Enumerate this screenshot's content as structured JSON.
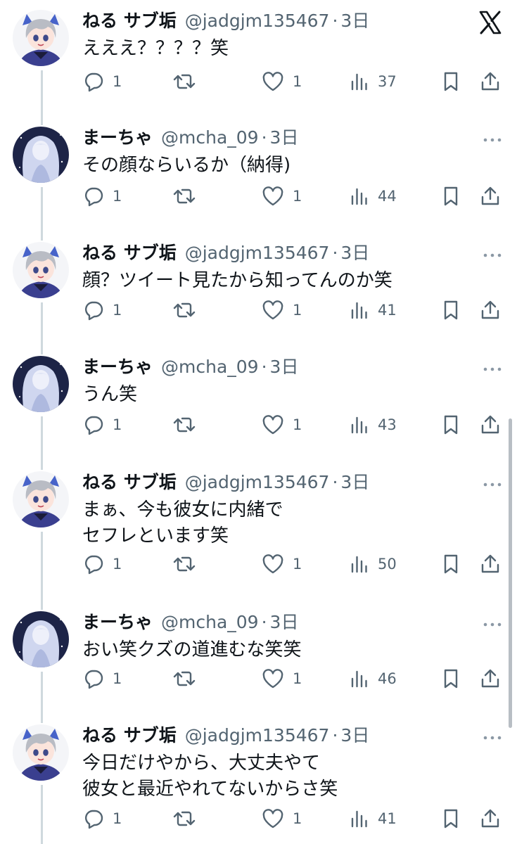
{
  "thread": {
    "tweets": [
      {
        "author": "ねる サブ垢",
        "handle": "@jadgjm135467",
        "separator": "·",
        "time": "3日",
        "text": "えええ？？？？笑",
        "replies": "1",
        "likes": "1",
        "views": "37",
        "avatar": "anime-boy-avatar"
      },
      {
        "author": "まーちゃ",
        "handle": "@mcha_09",
        "separator": "·",
        "time": "3日",
        "text": "その顔ならいるか（納得)",
        "replies": "1",
        "likes": "1",
        "views": "44",
        "avatar": "anime-girl-avatar"
      },
      {
        "author": "ねる サブ垢",
        "handle": "@jadgjm135467",
        "separator": "·",
        "time": "3日",
        "text": "顔？ツイート見たから知ってんのか笑",
        "replies": "1",
        "likes": "1",
        "views": "41",
        "avatar": "anime-boy-avatar"
      },
      {
        "author": "まーちゃ",
        "handle": "@mcha_09",
        "separator": "·",
        "time": "3日",
        "text": "うん笑",
        "replies": "1",
        "likes": "1",
        "views": "43",
        "avatar": "anime-girl-avatar"
      },
      {
        "author": "ねる サブ垢",
        "handle": "@jadgjm135467",
        "separator": "·",
        "time": "3日",
        "text": "まぁ、今も彼女に内緒で\nセフレといます笑",
        "replies": "1",
        "likes": "1",
        "views": "50",
        "avatar": "anime-boy-avatar"
      },
      {
        "author": "まーちゃ",
        "handle": "@mcha_09",
        "separator": "·",
        "time": "3日",
        "text": "おい笑クズの道進むな笑笑",
        "replies": "1",
        "likes": "1",
        "views": "46",
        "avatar": "anime-girl-avatar"
      },
      {
        "author": "ねる サブ垢",
        "handle": "@jadgjm135467",
        "separator": "·",
        "time": "3日",
        "text": "今日だけやから、大丈夫やて\n彼女と最近やれてないからさ笑",
        "replies": "1",
        "likes": "1",
        "views": "41",
        "avatar": "anime-boy-avatar"
      }
    ]
  },
  "icons": {
    "corner": "x-logo-icon",
    "more": "more-options-icon",
    "reply": "reply-icon",
    "retweet": "retweet-icon",
    "like": "like-icon",
    "views": "views-icon",
    "bookmark": "bookmark-icon",
    "share": "share-icon"
  },
  "colors": {
    "text": "#0f1419",
    "secondary": "#536471",
    "thread_line": "#cfd9de"
  }
}
